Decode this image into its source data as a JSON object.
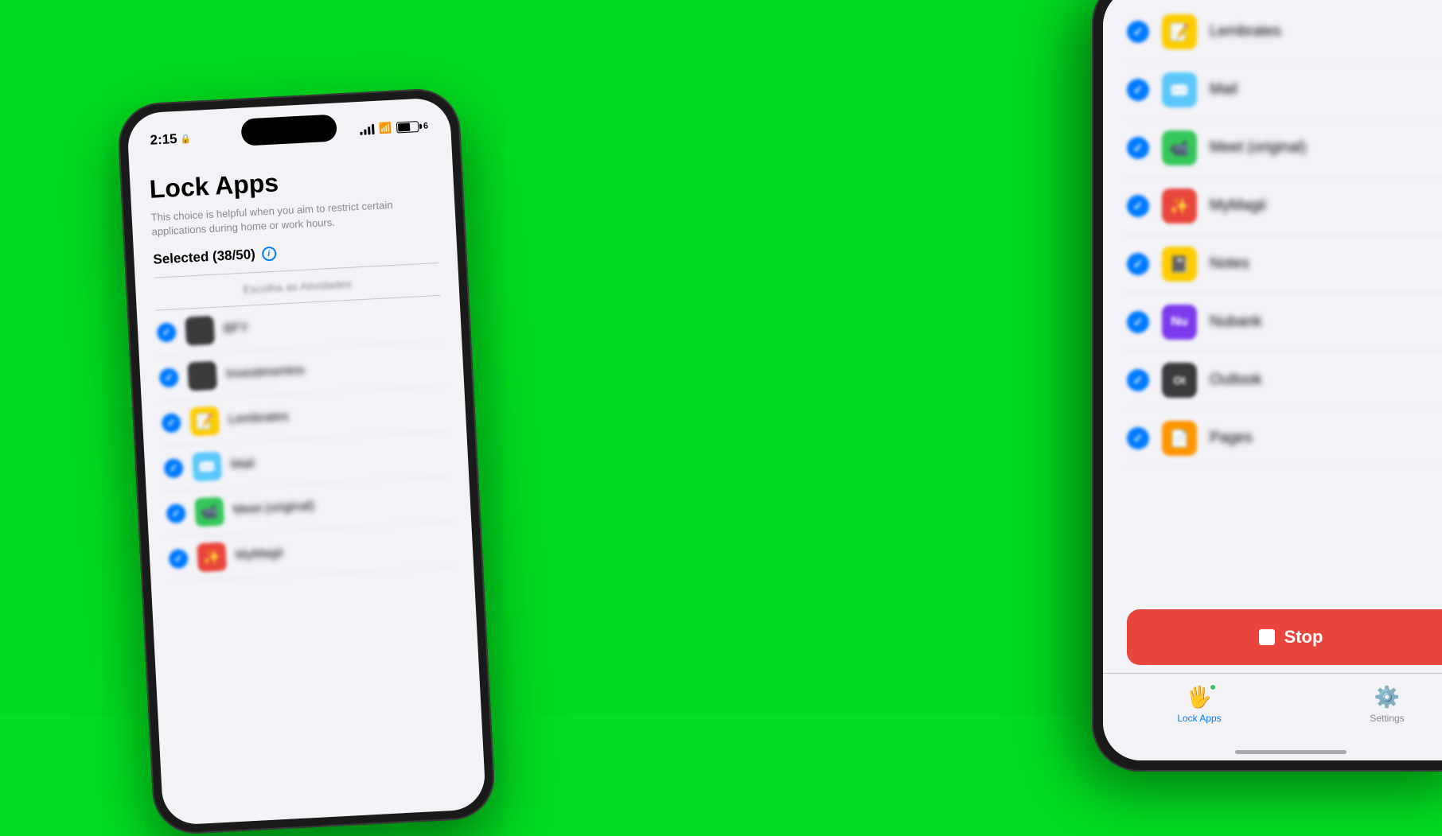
{
  "background": {
    "color": "#00dd1e"
  },
  "left_phone": {
    "status_bar": {
      "time": "2:15",
      "signal_bars": [
        4,
        7,
        10,
        13
      ],
      "battery_level": 65
    },
    "screen": {
      "title": "Lock Apps",
      "description": "This choice is helpful when you aim to restrict certain applications during home or work hours.",
      "selected_label": "Selected (38/50)",
      "section_header": "Escolha as Atividades",
      "apps": [
        {
          "name": "BFY",
          "icon_color": "#3a3a3c",
          "checked": true
        },
        {
          "name": "Investimentos",
          "icon_color": "#3a3a3c",
          "checked": true
        },
        {
          "name": "Lembrates",
          "icon_color": "#ffcc00",
          "checked": true
        },
        {
          "name": "Mail",
          "icon_color": "#5ac8fa",
          "checked": true
        },
        {
          "name": "Meet (original)",
          "icon_color": "#34c759",
          "checked": true
        },
        {
          "name": "MyMagii",
          "icon_color": "#e8453c",
          "checked": true
        }
      ]
    }
  },
  "right_phone": {
    "apps": [
      {
        "name": "Lembrates",
        "icon_color": "#ffcc00",
        "checked": true
      },
      {
        "name": "Mail",
        "icon_color": "#5ac8fa",
        "checked": true
      },
      {
        "name": "Meet (original)",
        "icon_color": "#34c759",
        "checked": true
      },
      {
        "name": "MyMagii",
        "icon_color": "#e8453c",
        "checked": true
      },
      {
        "name": "Notes",
        "icon_color": "#ffcc00",
        "checked": true
      },
      {
        "name": "Nubank",
        "icon_color": "#7c3aed",
        "checked": true
      },
      {
        "name": "Outlook",
        "icon_color": "#3a3a3c",
        "checked": true
      },
      {
        "name": "Pages",
        "icon_color": "#ff9500",
        "checked": true
      }
    ],
    "stop_button": {
      "label": "Stop",
      "color": "#e8453c"
    },
    "tab_bar": {
      "tabs": [
        {
          "label": "Lock Apps",
          "active": true,
          "icon": "🖐️",
          "has_dot": true
        },
        {
          "label": "Settings",
          "active": false,
          "icon": "⚙️",
          "has_dot": false
        }
      ]
    },
    "home_indicator": true
  }
}
